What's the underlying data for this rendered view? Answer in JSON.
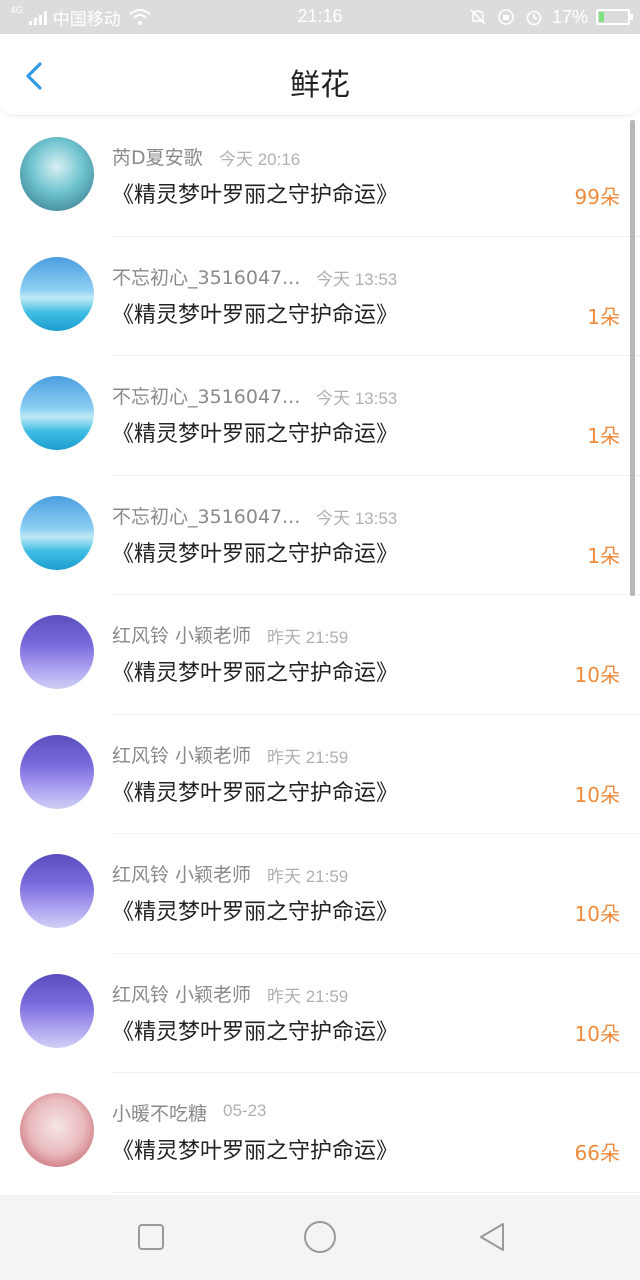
{
  "status_bar": {
    "network": "4G",
    "carrier": "中国移动",
    "time": "21:16",
    "battery_percent": "17%",
    "battery_level": 0.17,
    "icons": [
      "signal-icon",
      "wifi-icon",
      "mute-icon",
      "sync-icon",
      "alarm-icon",
      "battery-icon"
    ]
  },
  "header": {
    "title": "鲜花",
    "back_icon": "chevron-left-icon",
    "accent_color": "#2f9ae8"
  },
  "list": {
    "count_color": "#f08a3c",
    "items": [
      {
        "avatar": "anime-avatar",
        "name": "芮D夏安歌",
        "time": "今天 20:16",
        "title": "《精灵梦叶罗丽之守护命运》",
        "count": "99朵"
      },
      {
        "avatar": "beach-avatar",
        "name": "不忘初心_3516047...",
        "time": "今天 13:53",
        "title": "《精灵梦叶罗丽之守护命运》",
        "count": "1朵"
      },
      {
        "avatar": "beach-avatar",
        "name": "不忘初心_3516047...",
        "time": "今天 13:53",
        "title": "《精灵梦叶罗丽之守护命运》",
        "count": "1朵"
      },
      {
        "avatar": "beach-avatar",
        "name": "不忘初心_3516047...",
        "time": "今天 13:53",
        "title": "《精灵梦叶罗丽之守护命运》",
        "count": "1朵"
      },
      {
        "avatar": "sky-avatar",
        "name": "红风铃 小颖老师",
        "time": "昨天 21:59",
        "title": "《精灵梦叶罗丽之守护命运》",
        "count": "10朵"
      },
      {
        "avatar": "sky-avatar",
        "name": "红风铃 小颖老师",
        "time": "昨天 21:59",
        "title": "《精灵梦叶罗丽之守护命运》",
        "count": "10朵"
      },
      {
        "avatar": "sky-avatar",
        "name": "红风铃 小颖老师",
        "time": "昨天 21:59",
        "title": "《精灵梦叶罗丽之守护命运》",
        "count": "10朵"
      },
      {
        "avatar": "sky-avatar",
        "name": "红风铃 小颖老师",
        "time": "昨天 21:59",
        "title": "《精灵梦叶罗丽之守护命运》",
        "count": "10朵"
      },
      {
        "avatar": "girl-avatar",
        "name": "小暖不吃糖",
        "time": "05-23",
        "title": "《精灵梦叶罗丽之守护命运》",
        "count": "66朵"
      }
    ]
  },
  "navbar": {
    "icons": [
      "recent-apps-icon",
      "home-icon",
      "back-triangle-icon"
    ]
  }
}
